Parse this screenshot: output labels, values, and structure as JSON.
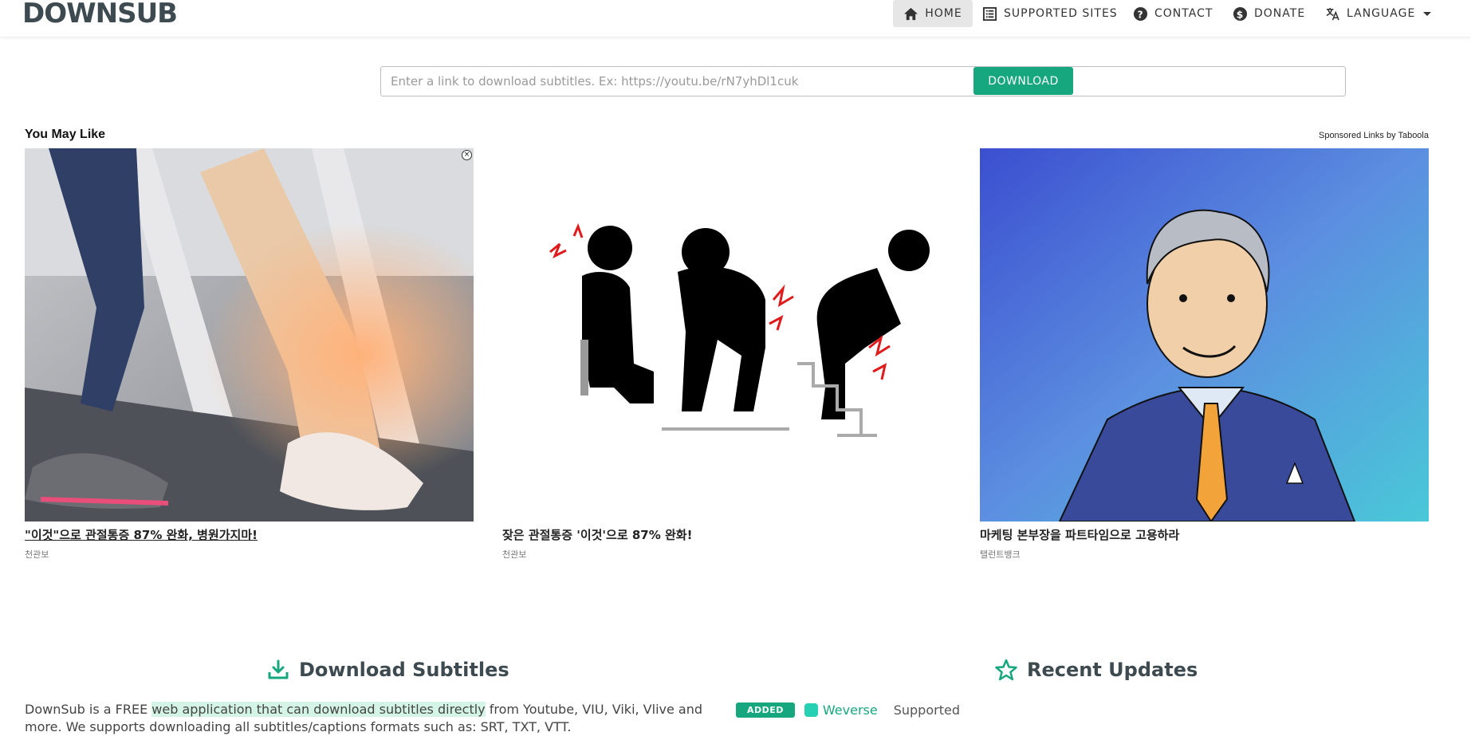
{
  "navbar": {
    "logo": "DOWNSUB",
    "items": [
      {
        "label": "HOME",
        "icon": "home-icon",
        "active": true
      },
      {
        "label": "SUPPORTED SITES",
        "icon": "list-icon"
      },
      {
        "label": "CONTACT",
        "icon": "question-circle-icon"
      },
      {
        "label": "DONATE",
        "icon": "dollar-circle-icon"
      },
      {
        "label": "LANGUAGE",
        "icon": "translate-icon"
      }
    ]
  },
  "search": {
    "placeholder": "Enter a link to download subtitles. Ex: https://youtu.be/rN7yhDl1cuk",
    "value": "",
    "button_label": "DOWNLOAD"
  },
  "ads": {
    "heading": "You May Like",
    "sponsored": "Sponsored Links by Taboola",
    "cards": [
      {
        "title": "\"이것\"으로 관절통증 87% 완화, 병원가지마!",
        "source": "천관보"
      },
      {
        "title": "잦은 관절통증 '이것'으로 87% 완화!",
        "source": "천관보"
      },
      {
        "title": "마케팅 본부장을 파트타임으로 고용하라",
        "source": "탤런트뱅크"
      }
    ]
  },
  "download_section": {
    "title": "Download Subtitles",
    "intro_pre": "DownSub is a FREE ",
    "intro_highlight": "web application that can download subtitles directly",
    "intro_post": " from Youtube, VIU, Viki, Vlive and more. We supports downloading all subtitles/captions formats such as: SRT, TXT, VTT."
  },
  "recent_updates": {
    "title": "Recent Updates",
    "items": [
      {
        "badge": "ADDED",
        "name": "Weverse",
        "status": "Supported"
      }
    ]
  },
  "colors": {
    "accent": "#16a77e",
    "logo": "#3d4a50"
  }
}
